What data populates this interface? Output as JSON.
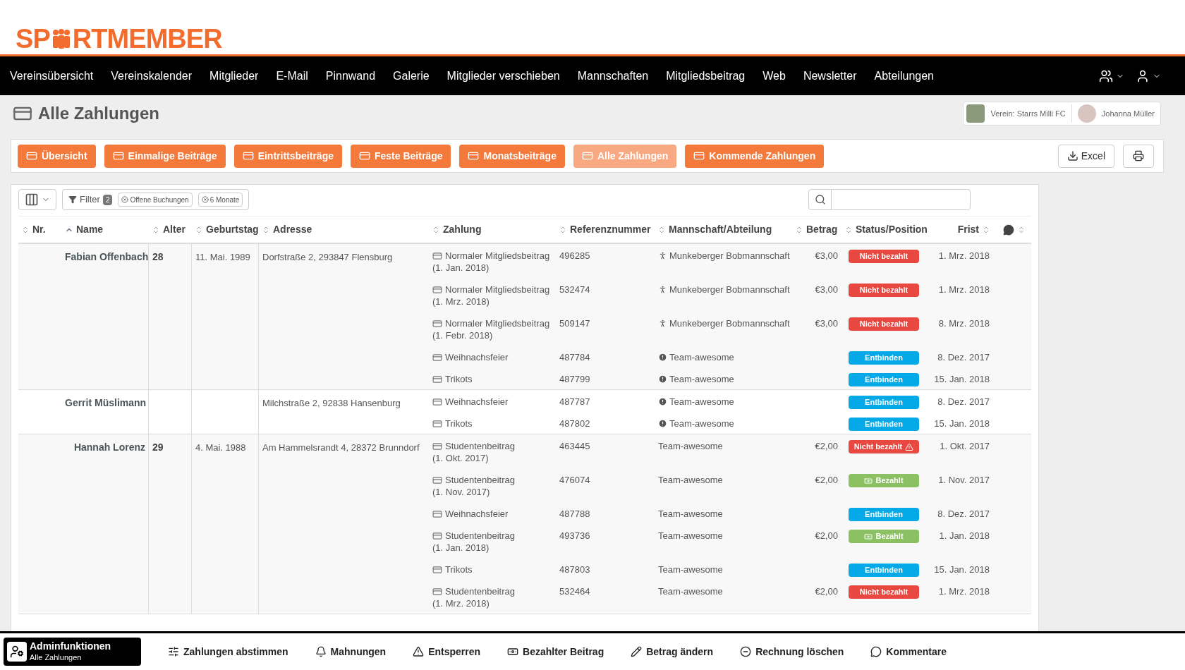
{
  "logo": {
    "before": "SP",
    "after": "RTMEMBER"
  },
  "nav": [
    "Vereinsübersicht",
    "Vereinskalender",
    "Mitglieder",
    "E-Mail",
    "Pinnwand",
    "Galerie",
    "Mitglieder verschieben",
    "Mannschaften",
    "Mitgliedsbeitrag",
    "Web",
    "Newsletter",
    "Abteilungen"
  ],
  "page_title": "Alle Zahlungen",
  "club": {
    "label": "Verein: Starrs Milli FC"
  },
  "user": {
    "name": "Johanna Müller"
  },
  "tabs": [
    {
      "label": "Übersicht",
      "selected": false
    },
    {
      "label": "Einmalige Beiträge",
      "selected": false
    },
    {
      "label": "Eintrittsbeiträge",
      "selected": false
    },
    {
      "label": "Feste Beiträge",
      "selected": false
    },
    {
      "label": "Monatsbeiträge",
      "selected": false
    },
    {
      "label": "Alle Zahlungen",
      "selected": true
    },
    {
      "label": "Kommende Zahlungen",
      "selected": false
    }
  ],
  "export_button": "Excel",
  "filter": {
    "label": "Filter",
    "count": "2",
    "chips": [
      "Offene Buchungen",
      "6 Monate"
    ]
  },
  "columns": [
    {
      "label": "Nr.",
      "sorted": false
    },
    {
      "label": "Name",
      "sorted": true
    },
    {
      "label": "Alter",
      "sorted": false
    },
    {
      "label": "Geburtstag",
      "sorted": false
    },
    {
      "label": "Adresse",
      "sorted": false
    },
    {
      "label": "Zahlung",
      "sorted": false
    },
    {
      "label": "Referenznummer",
      "sorted": false
    },
    {
      "label": "Mannschaft/Abteilung",
      "sorted": false
    },
    {
      "label": "Betrag",
      "sorted": false
    },
    {
      "label": "Status/Position",
      "sorted": false
    },
    {
      "label": "Frist",
      "sorted": false
    },
    {
      "kind": "comments",
      "sorted": false
    }
  ],
  "members": [
    {
      "name": "Fabian Offenbach",
      "age": "28",
      "birthday": "11. Mai. 1989",
      "address": "Dorfstraße 2, 293847 Flensburg",
      "payments": [
        {
          "title": "Normaler Mitgliedsbeitrag",
          "period": "(1. Jan. 2018)",
          "ref": "496285",
          "team": {
            "name": "Munkeberger Bobmannschaft",
            "kind": "member"
          },
          "amount": "€3,00",
          "status": {
            "label": "Nicht bezahlt",
            "kind": "unpaid",
            "alert": false
          },
          "due": "1. Mrz. 2018"
        },
        {
          "title": "Normaler Mitgliedsbeitrag",
          "period": "(1. Mrz. 2018)",
          "ref": "532474",
          "team": {
            "name": "Munkeberger Bobmannschaft",
            "kind": "member"
          },
          "amount": "€3,00",
          "status": {
            "label": "Nicht bezahlt",
            "kind": "unpaid",
            "alert": false
          },
          "due": "1. Mrz. 2018"
        },
        {
          "title": "Normaler Mitgliedsbeitrag",
          "period": "(1. Febr. 2018)",
          "ref": "509147",
          "team": {
            "name": "Munkeberger Bobmannschaft",
            "kind": "member"
          },
          "amount": "€3,00",
          "status": {
            "label": "Nicht bezahlt",
            "kind": "unpaid",
            "alert": false
          },
          "due": "8. Mrz. 2018"
        },
        {
          "title": "Weihnachsfeier",
          "ref": "487784",
          "team": {
            "name": "Team-awesome",
            "kind": "warning"
          },
          "status": {
            "label": "Entbinden",
            "kind": "release",
            "alert": false
          },
          "due": "8. Dez. 2017"
        },
        {
          "title": "Trikots",
          "ref": "487799",
          "team": {
            "name": "Team-awesome",
            "kind": "warning"
          },
          "status": {
            "label": "Entbinden",
            "kind": "release",
            "alert": false
          },
          "due": "15. Jan. 2018"
        }
      ]
    },
    {
      "name": "Gerrit Müslimann",
      "address": "Milchstraße 2, 92838 Hansenburg",
      "payments": [
        {
          "title": "Weihnachsfeier",
          "ref": "487787",
          "team": {
            "name": "Team-awesome",
            "kind": "warning"
          },
          "status": {
            "label": "Entbinden",
            "kind": "release",
            "alert": false
          },
          "due": "8. Dez. 2017"
        },
        {
          "title": "Trikots",
          "ref": "487802",
          "team": {
            "name": "Team-awesome",
            "kind": "warning"
          },
          "status": {
            "label": "Entbinden",
            "kind": "release",
            "alert": false
          },
          "due": "15. Jan. 2018"
        }
      ]
    },
    {
      "name": "Hannah Lorenz",
      "age": "29",
      "birthday": "4. Mai. 1988",
      "address": "Am Hammelsrandt 4, 28372 Brunndorf",
      "payments": [
        {
          "title": "Studentenbeitrag",
          "period": "(1. Okt. 2017)",
          "ref": "463445",
          "team": {
            "name": "Team-awesome",
            "kind": "plain"
          },
          "amount": "€2,00",
          "status": {
            "label": "Nicht bezahlt",
            "kind": "unpaid",
            "alert": true
          },
          "due": "1. Okt. 2017"
        },
        {
          "title": "Studentenbeitrag",
          "period": "(1. Nov. 2017)",
          "ref": "476074",
          "team": {
            "name": "Team-awesome",
            "kind": "plain"
          },
          "amount": "€2,00",
          "status": {
            "label": "Bezahlt",
            "kind": "paid",
            "alert": false
          },
          "due": "1. Nov. 2017"
        },
        {
          "title": "Weihnachsfeier",
          "ref": "487788",
          "team": {
            "name": "Team-awesome",
            "kind": "plain"
          },
          "status": {
            "label": "Entbinden",
            "kind": "release",
            "alert": false
          },
          "due": "8. Dez. 2017"
        },
        {
          "title": "Studentenbeitrag",
          "period": "(1. Jan. 2018)",
          "ref": "493736",
          "team": {
            "name": "Team-awesome",
            "kind": "plain"
          },
          "amount": "€2,00",
          "status": {
            "label": "Bezahlt",
            "kind": "paid",
            "alert": false
          },
          "due": "1. Jan. 2018"
        },
        {
          "title": "Trikots",
          "ref": "487803",
          "team": {
            "name": "Team-awesome",
            "kind": "plain"
          },
          "status": {
            "label": "Entbinden",
            "kind": "release",
            "alert": false
          },
          "due": "15. Jan. 2018"
        },
        {
          "title": "Studentenbeitrag",
          "period": "(1. Mrz. 2018)",
          "ref": "532464",
          "team": {
            "name": "Team-awesome",
            "kind": "plain"
          },
          "amount": "€2,00",
          "status": {
            "label": "Nicht bezahlt",
            "kind": "unpaid",
            "alert": false
          },
          "due": "1. Mrz. 2018"
        }
      ]
    }
  ],
  "admin": {
    "title": "Adminfunktionen",
    "subtitle": "Alle Zahlungen"
  },
  "actions": [
    "Zahlungen abstimmen",
    "Mahnungen",
    "Entsperren",
    "Bezahlter Beitrag",
    "Betrag ändern",
    "Rechnung löschen",
    "Kommentare"
  ]
}
